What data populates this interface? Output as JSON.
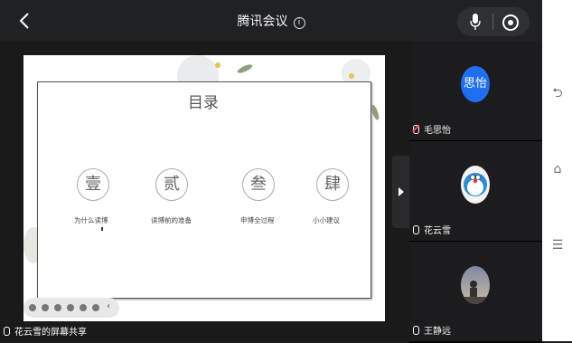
{
  "header": {
    "title": "腾讯会议",
    "info_icon": "info-icon",
    "back_icon": "chevron-left-icon",
    "mic_icon": "microphone-icon",
    "record_icon": "record-icon"
  },
  "share": {
    "label": "花云雪的屏幕共享",
    "slide": {
      "title": "目录",
      "items": [
        {
          "seal": "壹",
          "label": "为什么读博"
        },
        {
          "seal": "贰",
          "label": "读博前的准备"
        },
        {
          "seal": "叁",
          "label": "申博全过程"
        },
        {
          "seal": "肆",
          "label": "小小建议"
        }
      ]
    }
  },
  "participants": [
    {
      "name": "毛思怡",
      "avatar_text": "思怡",
      "mic": "muted"
    },
    {
      "name": "花云雪",
      "avatar_text": "",
      "mic": "on"
    },
    {
      "name": "王静远",
      "avatar_text": "",
      "mic": "on"
    }
  ],
  "colors": {
    "avatar_blue": "#1e6ef2",
    "muted_red": "#ff4d4f",
    "background": "#1c1c1e"
  },
  "system_nav": [
    "back-icon",
    "home-icon",
    "menu-icon"
  ]
}
